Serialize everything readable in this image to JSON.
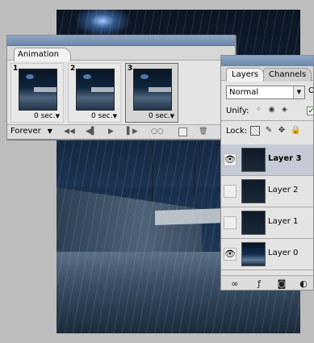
{
  "animation_panel": {
    "tab_label": "Animation",
    "frames": [
      {
        "number": "1",
        "delay": "0 sec.",
        "selected": false
      },
      {
        "number": "2",
        "delay": "0 sec.",
        "selected": false
      },
      {
        "number": "3",
        "delay": "0 sec.",
        "selected": true
      }
    ],
    "loop_label": "Forever",
    "controls": [
      "first-frame-icon",
      "previous-frame-icon",
      "play-icon",
      "next-frame-icon",
      "tween-icon",
      "duplicate-frame-icon",
      "delete-frame-icon"
    ]
  },
  "layers_panel": {
    "tabs": [
      "Layers",
      "Channels"
    ],
    "blend_mode": "Normal",
    "opacity_label_fragment": "O",
    "unify_label": "Unify:",
    "lock_label": "Lock:",
    "layers": [
      {
        "name": "Layer 3",
        "visible": true,
        "selected": true
      },
      {
        "name": "Layer 2",
        "visible": false,
        "selected": false
      },
      {
        "name": "Layer 1",
        "visible": false,
        "selected": false
      },
      {
        "name": "Layer 0",
        "visible": true,
        "selected": false
      }
    ]
  },
  "colors": {
    "panel_bg": "#e4e4e4",
    "selected_row": "#c4cbd6",
    "workspace_bg": "#bdbdbd"
  }
}
